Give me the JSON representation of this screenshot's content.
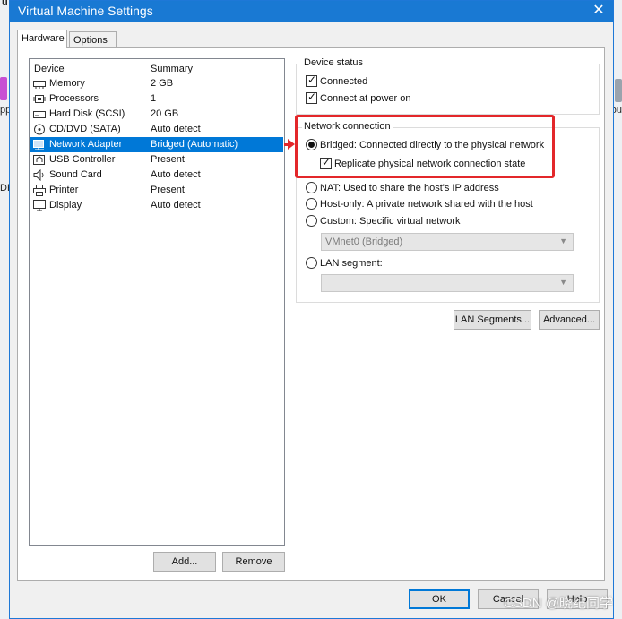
{
  "desktop": {
    "left_top": "u",
    "left_mid": "pp",
    "left_low": "DK",
    "right_mid": "ou"
  },
  "window": {
    "title": "Virtual Machine Settings",
    "close_glyph": "✕"
  },
  "tabs": [
    {
      "label": "Hardware",
      "active": true
    },
    {
      "label": "Options",
      "active": false
    }
  ],
  "devices": {
    "header_device": "Device",
    "header_summary": "Summary",
    "items": [
      {
        "name": "Memory",
        "summary": "2 GB",
        "icon": "memory-icon"
      },
      {
        "name": "Processors",
        "summary": "1",
        "icon": "processor-icon"
      },
      {
        "name": "Hard Disk (SCSI)",
        "summary": "20 GB",
        "icon": "hard-disk-icon"
      },
      {
        "name": "CD/DVD (SATA)",
        "summary": "Auto detect",
        "icon": "cd-dvd-icon"
      },
      {
        "name": "Network Adapter",
        "summary": "Bridged (Automatic)",
        "icon": "network-adapter-icon",
        "selected": true
      },
      {
        "name": "USB Controller",
        "summary": "Present",
        "icon": "usb-icon"
      },
      {
        "name": "Sound Card",
        "summary": "Auto detect",
        "icon": "sound-card-icon"
      },
      {
        "name": "Printer",
        "summary": "Present",
        "icon": "printer-icon"
      },
      {
        "name": "Display",
        "summary": "Auto detect",
        "icon": "display-icon"
      }
    ],
    "add_label": "Add...",
    "remove_label": "Remove"
  },
  "device_status": {
    "title": "Device status",
    "connected": "Connected",
    "connect_at_power_on": "Connect at power on"
  },
  "network_connection": {
    "title": "Network connection",
    "bridged": "Bridged: Connected directly to the physical network",
    "replicate": "Replicate physical network connection state",
    "nat": "NAT: Used to share the host's IP address",
    "host_only": "Host-only: A private network shared with the host",
    "custom": "Custom: Specific virtual network",
    "custom_value": "VMnet0 (Bridged)",
    "lan_segment": "LAN segment:",
    "lan_segment_value": ""
  },
  "buttons": {
    "lan_segments": "LAN Segments...",
    "advanced": "Advanced...",
    "ok": "OK",
    "cancel": "Cancel",
    "help": "Help"
  },
  "watermark": "CSDN @晓纪同学",
  "colors": {
    "title_bar": "#1979d3",
    "selection": "#0078d7",
    "annotation": "#e3272a"
  }
}
